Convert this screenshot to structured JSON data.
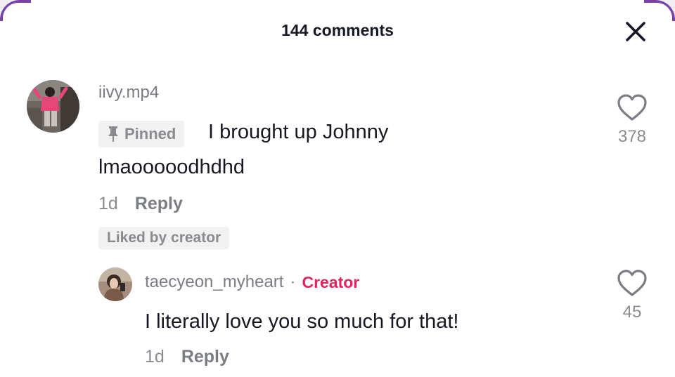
{
  "header": {
    "title": "144 comments",
    "close_icon": "close-icon"
  },
  "comment": {
    "username": "iivy.mp4",
    "pinned_label": "Pinned",
    "text_line1": "I brought up Johnny",
    "text_line2": "lmaooooodhdhd",
    "age": "1d",
    "reply_label": "Reply",
    "liked_badge": "Liked by creator",
    "like_count": "378",
    "like_icon": "heart-outline-icon"
  },
  "reply": {
    "username": "taecyeon_myheart",
    "separator": "·",
    "creator_label": "Creator",
    "creator_color": "#e0245e",
    "text": "I literally love you so much for that!",
    "age": "1d",
    "reply_label": "Reply",
    "like_count": "45",
    "like_icon": "heart-outline-icon"
  }
}
